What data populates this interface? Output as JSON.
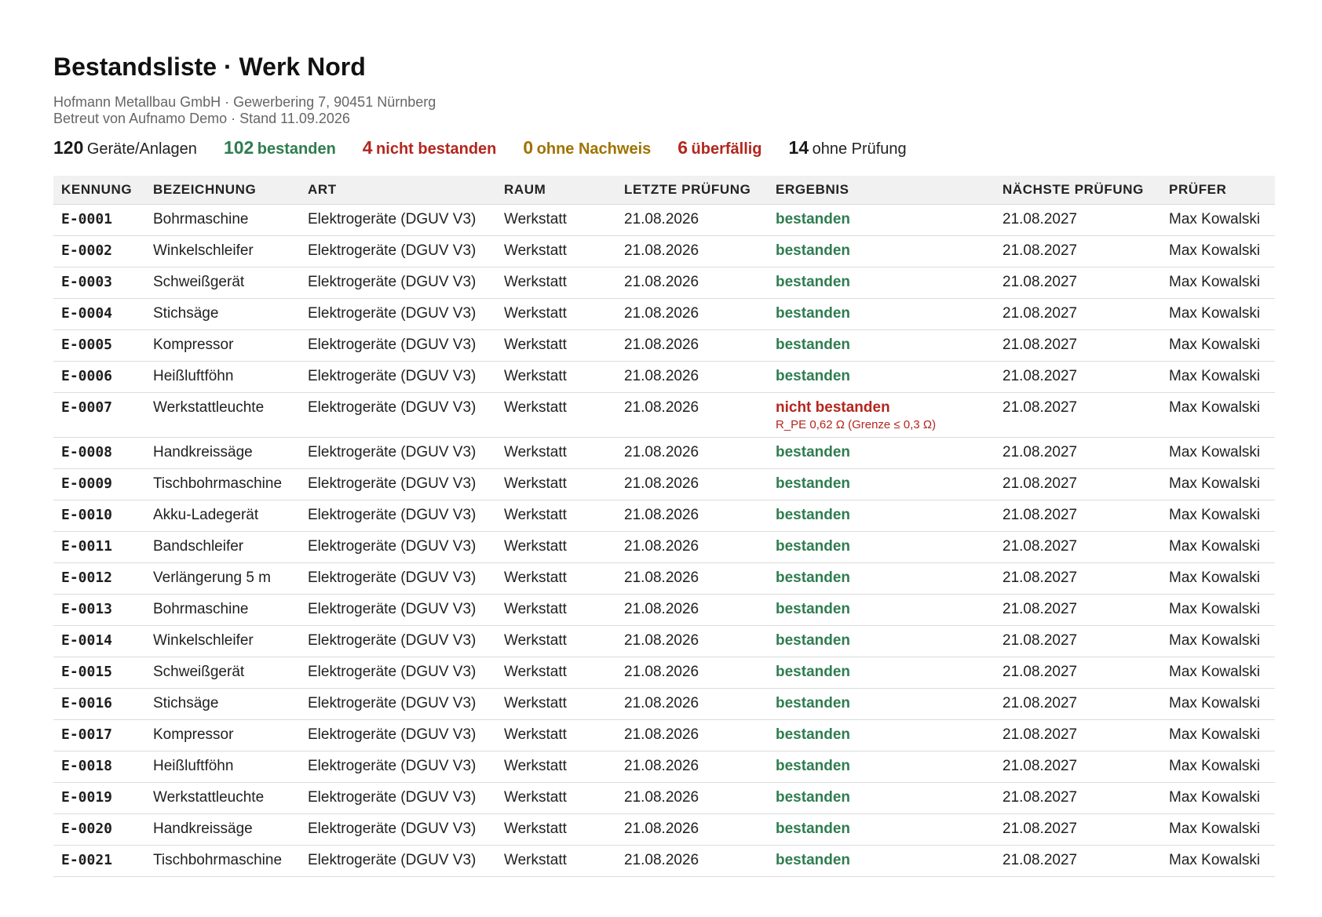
{
  "header": {
    "title": "Bestandsliste · Werk Nord",
    "company": "Hofmann Metallbau GmbH · Gewerbering 7, 90451 Nürnberg",
    "meta": "Betreut von Aufnamo Demo · Stand 11.09.2026"
  },
  "stats": {
    "total": {
      "num": "120",
      "label": "Geräte/Anlagen"
    },
    "passed": {
      "num": "102",
      "label": "bestanden"
    },
    "failed": {
      "num": "4",
      "label": "nicht bestanden"
    },
    "no_proof": {
      "num": "0",
      "label": "ohne Nachweis"
    },
    "overdue": {
      "num": "6",
      "label": "überfällig"
    },
    "unchecked": {
      "num": "14",
      "label": "ohne Prüfung"
    }
  },
  "colors": {
    "passed": "#2e7d4f",
    "failed": "#b3261e",
    "no_proof": "#a07300"
  },
  "table": {
    "headers": [
      "KENNUNG",
      "BEZEICHNUNG",
      "ART",
      "RAUM",
      "LETZTE PRÜFUNG",
      "ERGEBNIS",
      "NÄCHSTE PRÜFUNG",
      "PRÜFER"
    ],
    "rows": [
      {
        "id": "E-0001",
        "name": "Bohrmaschine",
        "type": "Elektrogeräte (DGUV V3)",
        "room": "Werkstatt",
        "last": "21.08.2026",
        "result": "bestanden",
        "status": "ok",
        "note": "",
        "next": "21.08.2027",
        "inspector": "Max Kowalski"
      },
      {
        "id": "E-0002",
        "name": "Winkelschleifer",
        "type": "Elektrogeräte (DGUV V3)",
        "room": "Werkstatt",
        "last": "21.08.2026",
        "result": "bestanden",
        "status": "ok",
        "note": "",
        "next": "21.08.2027",
        "inspector": "Max Kowalski"
      },
      {
        "id": "E-0003",
        "name": "Schweißgerät",
        "type": "Elektrogeräte (DGUV V3)",
        "room": "Werkstatt",
        "last": "21.08.2026",
        "result": "bestanden",
        "status": "ok",
        "note": "",
        "next": "21.08.2027",
        "inspector": "Max Kowalski"
      },
      {
        "id": "E-0004",
        "name": "Stichsäge",
        "type": "Elektrogeräte (DGUV V3)",
        "room": "Werkstatt",
        "last": "21.08.2026",
        "result": "bestanden",
        "status": "ok",
        "note": "",
        "next": "21.08.2027",
        "inspector": "Max Kowalski"
      },
      {
        "id": "E-0005",
        "name": "Kompressor",
        "type": "Elektrogeräte (DGUV V3)",
        "room": "Werkstatt",
        "last": "21.08.2026",
        "result": "bestanden",
        "status": "ok",
        "note": "",
        "next": "21.08.2027",
        "inspector": "Max Kowalski"
      },
      {
        "id": "E-0006",
        "name": "Heißluftföhn",
        "type": "Elektrogeräte (DGUV V3)",
        "room": "Werkstatt",
        "last": "21.08.2026",
        "result": "bestanden",
        "status": "ok",
        "note": "",
        "next": "21.08.2027",
        "inspector": "Max Kowalski"
      },
      {
        "id": "E-0007",
        "name": "Werkstattleuchte",
        "type": "Elektrogeräte (DGUV V3)",
        "room": "Werkstatt",
        "last": "21.08.2026",
        "result": "nicht bestanden",
        "status": "fail",
        "note": "R_PE 0,62 Ω (Grenze ≤ 0,3 Ω)",
        "next": "21.08.2027",
        "inspector": "Max Kowalski"
      },
      {
        "id": "E-0008",
        "name": "Handkreissäge",
        "type": "Elektrogeräte (DGUV V3)",
        "room": "Werkstatt",
        "last": "21.08.2026",
        "result": "bestanden",
        "status": "ok",
        "note": "",
        "next": "21.08.2027",
        "inspector": "Max Kowalski"
      },
      {
        "id": "E-0009",
        "name": "Tischbohrmaschine",
        "type": "Elektrogeräte (DGUV V3)",
        "room": "Werkstatt",
        "last": "21.08.2026",
        "result": "bestanden",
        "status": "ok",
        "note": "",
        "next": "21.08.2027",
        "inspector": "Max Kowalski"
      },
      {
        "id": "E-0010",
        "name": "Akku-Ladegerät",
        "type": "Elektrogeräte (DGUV V3)",
        "room": "Werkstatt",
        "last": "21.08.2026",
        "result": "bestanden",
        "status": "ok",
        "note": "",
        "next": "21.08.2027",
        "inspector": "Max Kowalski"
      },
      {
        "id": "E-0011",
        "name": "Bandschleifer",
        "type": "Elektrogeräte (DGUV V3)",
        "room": "Werkstatt",
        "last": "21.08.2026",
        "result": "bestanden",
        "status": "ok",
        "note": "",
        "next": "21.08.2027",
        "inspector": "Max Kowalski"
      },
      {
        "id": "E-0012",
        "name": "Verlängerung 5 m",
        "type": "Elektrogeräte (DGUV V3)",
        "room": "Werkstatt",
        "last": "21.08.2026",
        "result": "bestanden",
        "status": "ok",
        "note": "",
        "next": "21.08.2027",
        "inspector": "Max Kowalski"
      },
      {
        "id": "E-0013",
        "name": "Bohrmaschine",
        "type": "Elektrogeräte (DGUV V3)",
        "room": "Werkstatt",
        "last": "21.08.2026",
        "result": "bestanden",
        "status": "ok",
        "note": "",
        "next": "21.08.2027",
        "inspector": "Max Kowalski"
      },
      {
        "id": "E-0014",
        "name": "Winkelschleifer",
        "type": "Elektrogeräte (DGUV V3)",
        "room": "Werkstatt",
        "last": "21.08.2026",
        "result": "bestanden",
        "status": "ok",
        "note": "",
        "next": "21.08.2027",
        "inspector": "Max Kowalski"
      },
      {
        "id": "E-0015",
        "name": "Schweißgerät",
        "type": "Elektrogeräte (DGUV V3)",
        "room": "Werkstatt",
        "last": "21.08.2026",
        "result": "bestanden",
        "status": "ok",
        "note": "",
        "next": "21.08.2027",
        "inspector": "Max Kowalski"
      },
      {
        "id": "E-0016",
        "name": "Stichsäge",
        "type": "Elektrogeräte (DGUV V3)",
        "room": "Werkstatt",
        "last": "21.08.2026",
        "result": "bestanden",
        "status": "ok",
        "note": "",
        "next": "21.08.2027",
        "inspector": "Max Kowalski"
      },
      {
        "id": "E-0017",
        "name": "Kompressor",
        "type": "Elektrogeräte (DGUV V3)",
        "room": "Werkstatt",
        "last": "21.08.2026",
        "result": "bestanden",
        "status": "ok",
        "note": "",
        "next": "21.08.2027",
        "inspector": "Max Kowalski"
      },
      {
        "id": "E-0018",
        "name": "Heißluftföhn",
        "type": "Elektrogeräte (DGUV V3)",
        "room": "Werkstatt",
        "last": "21.08.2026",
        "result": "bestanden",
        "status": "ok",
        "note": "",
        "next": "21.08.2027",
        "inspector": "Max Kowalski"
      },
      {
        "id": "E-0019",
        "name": "Werkstattleuchte",
        "type": "Elektrogeräte (DGUV V3)",
        "room": "Werkstatt",
        "last": "21.08.2026",
        "result": "bestanden",
        "status": "ok",
        "note": "",
        "next": "21.08.2027",
        "inspector": "Max Kowalski"
      },
      {
        "id": "E-0020",
        "name": "Handkreissäge",
        "type": "Elektrogeräte (DGUV V3)",
        "room": "Werkstatt",
        "last": "21.08.2026",
        "result": "bestanden",
        "status": "ok",
        "note": "",
        "next": "21.08.2027",
        "inspector": "Max Kowalski"
      },
      {
        "id": "E-0021",
        "name": "Tischbohrmaschine",
        "type": "Elektrogeräte (DGUV V3)",
        "room": "Werkstatt",
        "last": "21.08.2026",
        "result": "bestanden",
        "status": "ok",
        "note": "",
        "next": "21.08.2027",
        "inspector": "Max Kowalski"
      }
    ]
  }
}
